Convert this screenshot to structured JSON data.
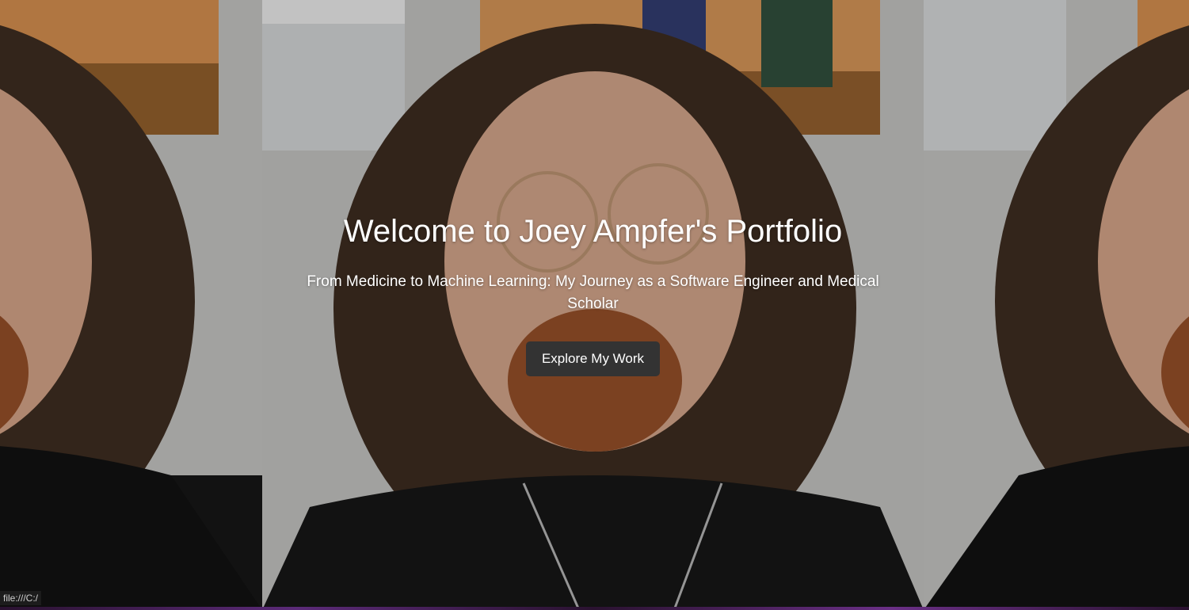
{
  "hero": {
    "title": "Welcome to Joey Ampfer's Portfolio",
    "subtitle": "From Medicine to Machine Learning: My Journey as a Software Engineer and Medical Scholar",
    "cta_label": "Explore My Work",
    "background_image": "portrait-photo",
    "cta_color": "#333333"
  },
  "status_bar": {
    "url": "file:///C:/"
  }
}
